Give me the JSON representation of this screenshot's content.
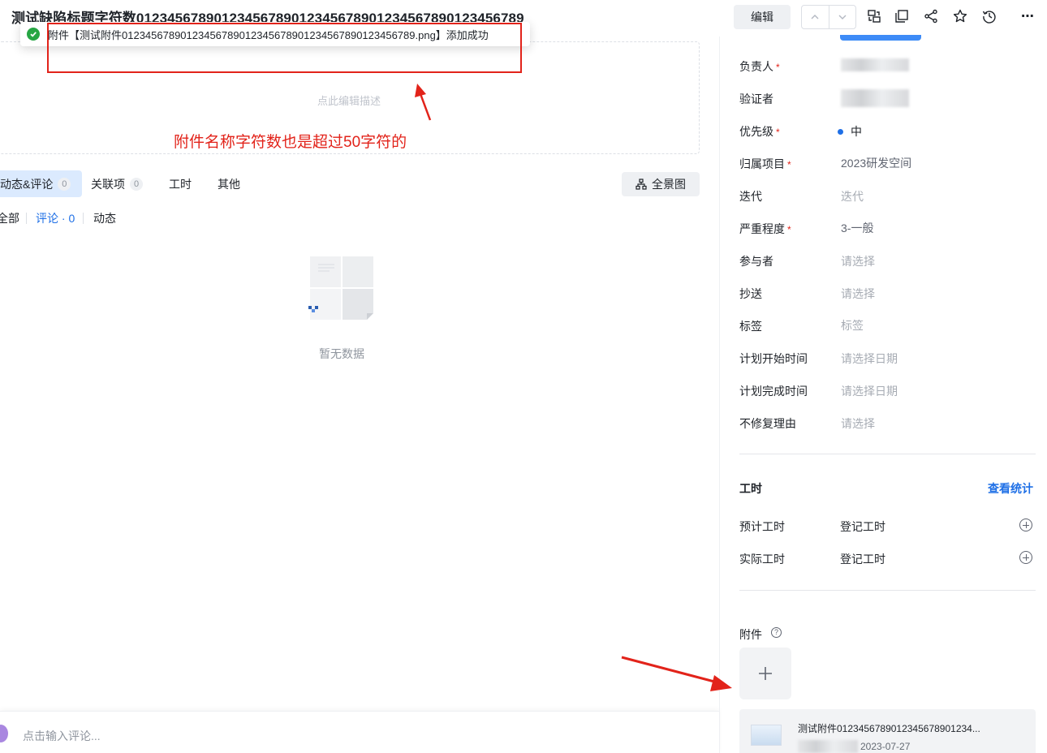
{
  "header": {
    "title": "测试缺陷标题字符数01234567890123456789012345678901234567890123456789",
    "edit_label": "编辑",
    "more_label": "⋯"
  },
  "toast": {
    "message": "附件【测试附件01234567890123456789012345678901234567890123456789.png】添加成功"
  },
  "annotation": {
    "note": "附件名称字符数也是超过50字符的"
  },
  "description": {
    "placeholder": "点此编辑描述"
  },
  "tabs": [
    {
      "label": "动态&评论",
      "count": "0",
      "active": true
    },
    {
      "label": "关联项",
      "count": "0",
      "active": false
    },
    {
      "label": "工时",
      "active": false
    },
    {
      "label": "其他",
      "active": false
    }
  ],
  "panorama_label": "全景图",
  "filters": {
    "all": "全部",
    "comments": "评论 · 0",
    "activity": "动态"
  },
  "empty": {
    "text": "暂无数据"
  },
  "comment": {
    "placeholder": "点击输入评论..."
  },
  "fields": [
    {
      "label": "负责人",
      "required": true,
      "value": "",
      "style": "blur"
    },
    {
      "label": "验证者",
      "required": false,
      "value": "",
      "style": "blur"
    },
    {
      "label": "优先级",
      "required": true,
      "value": "中",
      "style": "priority"
    },
    {
      "label": "归属项目",
      "required": true,
      "value": "2023研发空间",
      "style": "dark-gray"
    },
    {
      "label": "迭代",
      "required": false,
      "value": "迭代",
      "style": "muted"
    },
    {
      "label": "严重程度",
      "required": true,
      "value": "3-一般",
      "style": "dark-gray"
    },
    {
      "label": "参与者",
      "required": false,
      "value": "请选择",
      "style": "muted"
    },
    {
      "label": "抄送",
      "required": false,
      "value": "请选择",
      "style": "muted"
    },
    {
      "label": "标签",
      "required": false,
      "value": "标签",
      "style": "muted"
    },
    {
      "label": "计划开始时间",
      "required": false,
      "value": "请选择日期",
      "style": "muted"
    },
    {
      "label": "计划完成时间",
      "required": false,
      "value": "请选择日期",
      "style": "muted"
    },
    {
      "label": "不修复理由",
      "required": false,
      "value": "请选择",
      "style": "muted"
    }
  ],
  "worktime": {
    "title": "工时",
    "stats_link": "查看统计",
    "rows": [
      {
        "label": "预计工时",
        "action": "登记工时"
      },
      {
        "label": "实际工时",
        "action": "登记工时"
      }
    ]
  },
  "attachments": {
    "title": "附件",
    "files": [
      {
        "name": "测试附件0123456789012345678901234...",
        "date": "2023-07-27"
      }
    ]
  },
  "colors": {
    "accent": "#1e6fe6",
    "annotation_red": "#e2231a",
    "success_green": "#27a644",
    "required_star": "#e2231a"
  }
}
